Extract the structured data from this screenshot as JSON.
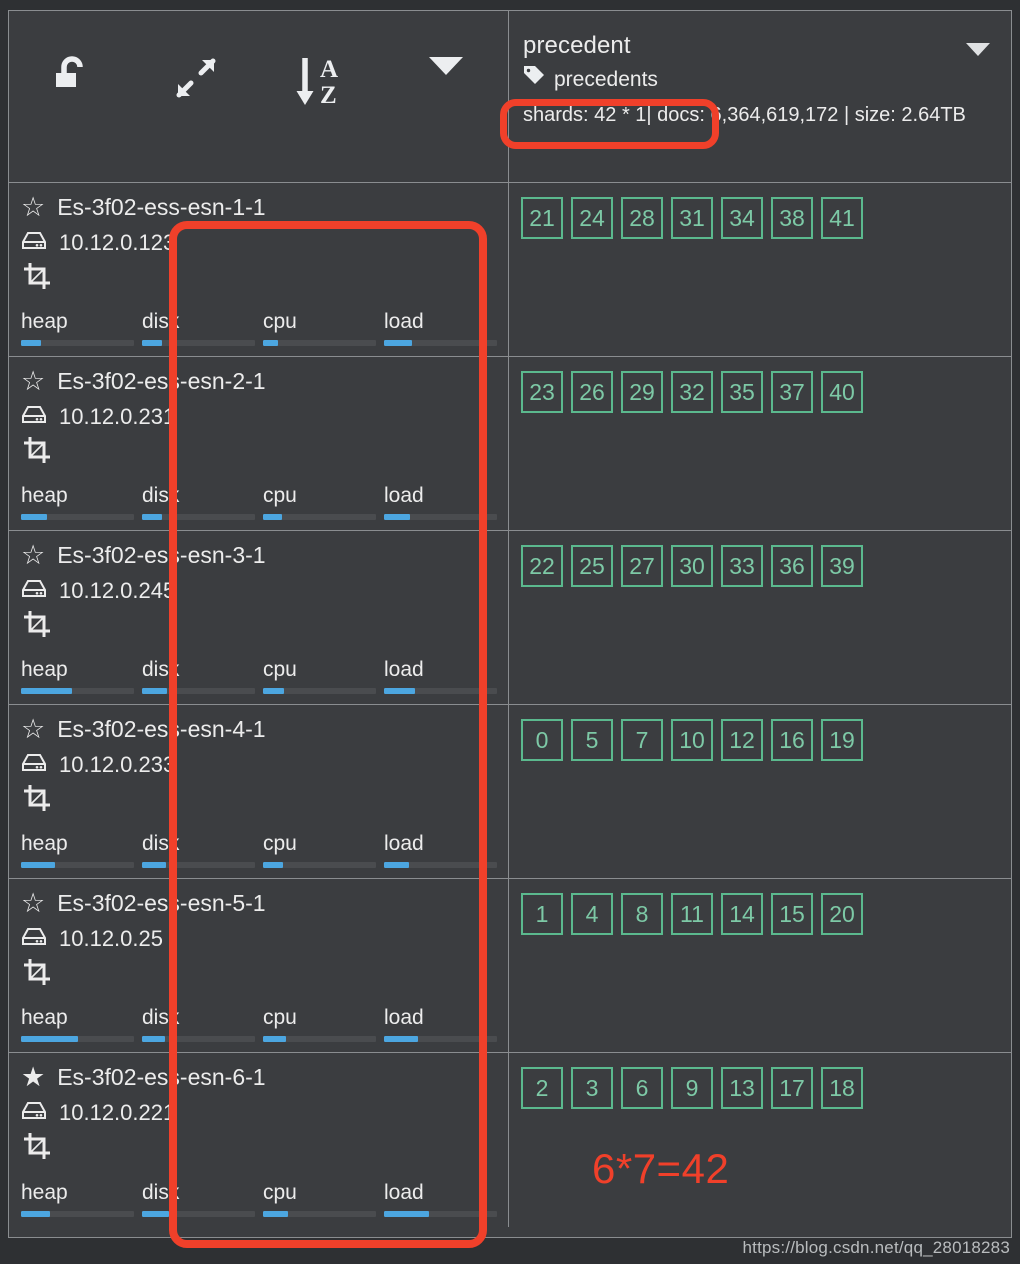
{
  "toolbar": {
    "buttons": [
      {
        "name": "unlock-icon",
        "label": "Unlock"
      },
      {
        "name": "expand-icon",
        "label": "Expand"
      },
      {
        "name": "sort-az-icon",
        "label": "Sort A-Z"
      },
      {
        "name": "chevron-down-icon",
        "label": "More"
      }
    ]
  },
  "index": {
    "name": "precedent",
    "alias": "precedents",
    "stats": "shards: 42 * 1| docs: 6,364,619,172 | size: 2.64TB",
    "caret": "▼"
  },
  "metric_labels": [
    "heap",
    "disk",
    "cpu",
    "load"
  ],
  "nodes": [
    {
      "name": "Es-3f02-ess-esn-1-1",
      "ip": "10.12.0.123",
      "master": false,
      "star": "☆",
      "metrics": [
        18,
        18,
        13,
        25
      ],
      "shards": [
        "21",
        "24",
        "28",
        "31",
        "34",
        "38",
        "41"
      ]
    },
    {
      "name": "Es-3f02-ess-esn-2-1",
      "ip": "10.12.0.231",
      "master": false,
      "star": "☆",
      "metrics": [
        23,
        18,
        17,
        23
      ],
      "shards": [
        "23",
        "26",
        "29",
        "32",
        "35",
        "37",
        "40"
      ]
    },
    {
      "name": "Es-3f02-ess-esn-3-1",
      "ip": "10.12.0.245",
      "master": false,
      "star": "☆",
      "metrics": [
        45,
        22,
        19,
        27
      ],
      "shards": [
        "22",
        "25",
        "27",
        "30",
        "33",
        "36",
        "39"
      ]
    },
    {
      "name": "Es-3f02-ess-esn-4-1",
      "ip": "10.12.0.233",
      "master": false,
      "star": "☆",
      "metrics": [
        30,
        21,
        18,
        22
      ],
      "shards": [
        "0",
        "5",
        "7",
        "10",
        "12",
        "16",
        "19"
      ]
    },
    {
      "name": "Es-3f02-ess-esn-5-1",
      "ip": "10.12.0.25",
      "master": false,
      "star": "☆",
      "metrics": [
        50,
        20,
        20,
        30
      ],
      "shards": [
        "1",
        "4",
        "8",
        "11",
        "14",
        "15",
        "20"
      ]
    },
    {
      "name": "Es-3f02-ess-esn-6-1",
      "ip": "10.12.0.221",
      "master": true,
      "star": "★",
      "metrics": [
        26,
        24,
        22,
        40
      ],
      "shards": [
        "2",
        "3",
        "6",
        "9",
        "13",
        "17",
        "18"
      ]
    }
  ],
  "annotations": {
    "equation": "6*7=42",
    "highlight_color": "#f0402a",
    "shard_border_color": "#5bb98e",
    "metric_fill_color": "#4ca6e0"
  },
  "watermark": "https://blog.csdn.net/qq_28018283"
}
